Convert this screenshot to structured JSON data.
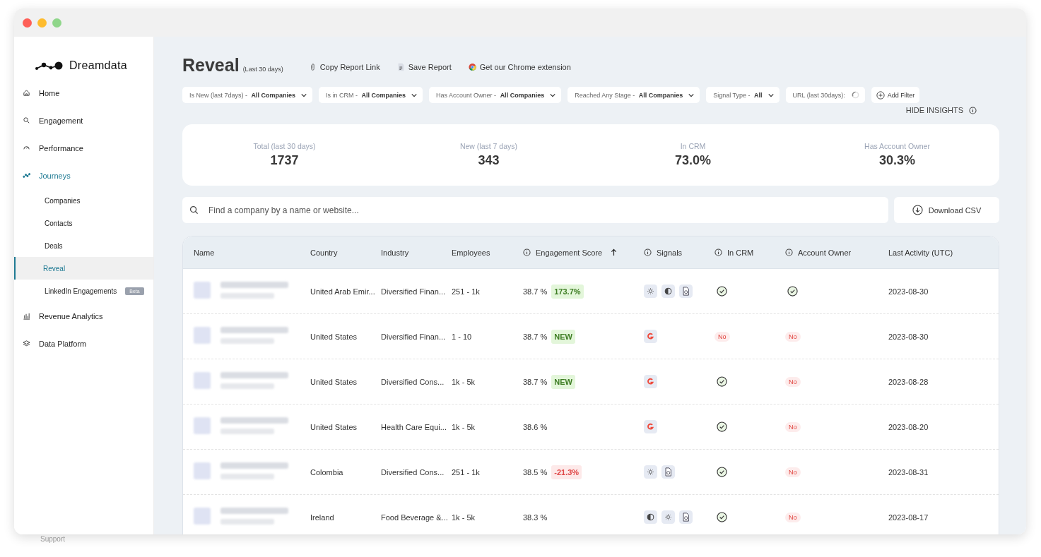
{
  "sidebar": {
    "logo": "Dreamdata",
    "items": [
      {
        "label": "Home",
        "selected": false
      },
      {
        "label": "Engagement",
        "selected": false
      },
      {
        "label": "Performance",
        "selected": false
      },
      {
        "label": "Journeys",
        "selected": true,
        "children": [
          {
            "label": "Companies",
            "selected": false
          },
          {
            "label": "Contacts",
            "selected": false
          },
          {
            "label": "Deals",
            "selected": false
          },
          {
            "label": "Reveal",
            "selected": true
          },
          {
            "label": "LinkedIn Engagements",
            "badge": "Beta",
            "selected": false
          }
        ]
      },
      {
        "label": "Revenue Analytics",
        "selected": false
      },
      {
        "label": "Data Platform",
        "selected": false
      }
    ],
    "footer": "Support"
  },
  "header": {
    "title": "Reveal",
    "subtitle": "(Last 30 days)",
    "actions": [
      {
        "label": "Copy Report Link"
      },
      {
        "label": "Save Report"
      },
      {
        "label": "Get our Chrome extension"
      }
    ]
  },
  "filters": [
    {
      "label": "Is New (last 7days) - ",
      "value": "All Companies",
      "kind": "dropdown"
    },
    {
      "label": "Is in CRM - ",
      "value": "All Companies",
      "kind": "dropdown"
    },
    {
      "label": "Has Account Owner - ",
      "value": "All Companies",
      "kind": "dropdown"
    },
    {
      "label": "Reached Any Stage - ",
      "value": "All Companies",
      "kind": "dropdown"
    },
    {
      "label": "Signal Type - ",
      "value": "All",
      "kind": "dropdown"
    },
    {
      "label": "URL (last 30days):",
      "kind": "loading"
    }
  ],
  "add_filter": "Add Filter",
  "hide_insights": "HIDE INSIGHTS",
  "stats": [
    {
      "label": "Total (last 30 days)",
      "value": "1737"
    },
    {
      "label": "New (last 7 days)",
      "value": "343"
    },
    {
      "label": "In CRM",
      "value": "73.0%"
    },
    {
      "label": "Has Account Owner",
      "value": "30.3%"
    }
  ],
  "search": {
    "placeholder": "Find a company by a name or website..."
  },
  "download": "Download CSV",
  "table": {
    "columns": [
      {
        "label": "Name",
        "info": false,
        "sorted": false
      },
      {
        "label": "Country",
        "info": false,
        "sorted": false
      },
      {
        "label": "Industry",
        "info": false,
        "sorted": false
      },
      {
        "label": "Employees",
        "info": false,
        "sorted": false
      },
      {
        "label": "Engagement Score",
        "info": true,
        "sorted": true
      },
      {
        "label": "Signals",
        "info": true,
        "sorted": false
      },
      {
        "label": "In CRM",
        "info": true,
        "sorted": false
      },
      {
        "label": "Account Owner",
        "info": true,
        "sorted": false
      },
      {
        "label": "Last Activity (UTC)",
        "info": false,
        "sorted": false
      }
    ],
    "rows": [
      {
        "country": "United Arab Emir...",
        "industry": "Diversified Finan...",
        "employees": "251 - 1k",
        "score": "38.7 %",
        "change": {
          "kind": "up",
          "text": "173.7%"
        },
        "signals": [
          {
            "kind": "sun"
          },
          {
            "kind": "contrast"
          },
          {
            "kind": "document"
          }
        ],
        "in_crm": {
          "kind": "check"
        },
        "owner": {
          "kind": "check"
        },
        "last_activity": "2023-08-30"
      },
      {
        "country": "United States",
        "industry": "Diversified Finan...",
        "employees": "1 - 10",
        "score": "38.7 %",
        "change": {
          "kind": "new",
          "text": "NEW"
        },
        "signals": [
          {
            "kind": "g2"
          }
        ],
        "in_crm": {
          "kind": "no",
          "text": "No"
        },
        "owner": {
          "kind": "no",
          "text": "No"
        },
        "last_activity": "2023-08-30"
      },
      {
        "country": "United States",
        "industry": "Diversified Cons...",
        "employees": "1k - 5k",
        "score": "38.7 %",
        "change": {
          "kind": "new",
          "text": "NEW"
        },
        "signals": [
          {
            "kind": "g2"
          }
        ],
        "in_crm": {
          "kind": "check"
        },
        "owner": {
          "kind": "no",
          "text": "No"
        },
        "last_activity": "2023-08-28"
      },
      {
        "country": "United States",
        "industry": "Health Care Equi...",
        "employees": "1k - 5k",
        "score": "38.6 %",
        "signals": [
          {
            "kind": "g2"
          }
        ],
        "in_crm": {
          "kind": "check"
        },
        "owner": {
          "kind": "no",
          "text": "No"
        },
        "last_activity": "2023-08-20"
      },
      {
        "country": "Colombia",
        "industry": "Diversified Cons...",
        "employees": "251 - 1k",
        "score": "38.5 %",
        "change": {
          "kind": "down",
          "text": "-21.3%"
        },
        "signals": [
          {
            "kind": "sun"
          },
          {
            "kind": "document"
          }
        ],
        "in_crm": {
          "kind": "check"
        },
        "owner": {
          "kind": "no",
          "text": "No"
        },
        "last_activity": "2023-08-31"
      },
      {
        "country": "Ireland",
        "industry": "Food Beverage &...",
        "employees": "1k - 5k",
        "score": "38.3 %",
        "signals": [
          {
            "kind": "contrast"
          },
          {
            "kind": "sun"
          },
          {
            "kind": "document"
          }
        ],
        "in_crm": {
          "kind": "check"
        },
        "owner": {
          "kind": "no",
          "text": "No"
        },
        "last_activity": "2023-08-17"
      }
    ]
  }
}
